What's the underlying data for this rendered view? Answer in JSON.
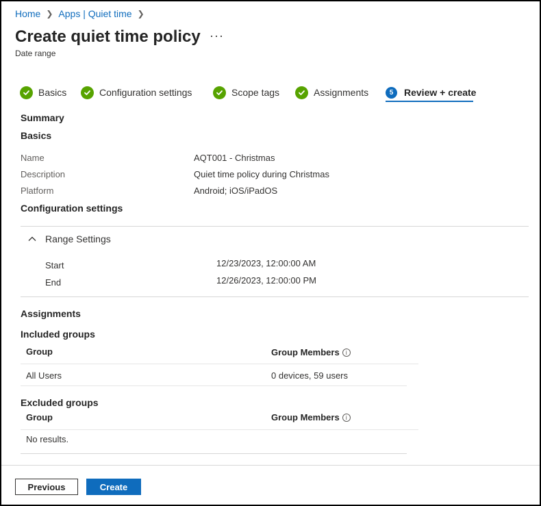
{
  "breadcrumb": {
    "items": [
      "Home",
      "Apps | Quiet time"
    ]
  },
  "header": {
    "title": "Create quiet time policy",
    "more": "···",
    "subtitle": "Date range"
  },
  "steps": [
    {
      "label": "Basics",
      "state": "done"
    },
    {
      "label": "Configuration settings",
      "state": "done"
    },
    {
      "label": "Scope tags",
      "state": "done"
    },
    {
      "label": "Assignments",
      "state": "done"
    },
    {
      "label": "Review + create",
      "number": "5",
      "state": "active"
    }
  ],
  "summary": {
    "heading": "Summary",
    "basics": {
      "heading": "Basics",
      "rows": [
        {
          "label": "Name",
          "value": "AQT001 - Christmas"
        },
        {
          "label": "Description",
          "value": "Quiet time policy during Christmas"
        },
        {
          "label": "Platform",
          "value": "Android; iOS/iPadOS"
        }
      ]
    },
    "config": {
      "heading": "Configuration settings",
      "group_title": "Range Settings",
      "rows": [
        {
          "label": "Start",
          "value": "12/23/2023, 12:00:00 AM"
        },
        {
          "label": "End",
          "value": "12/26/2023, 12:00:00 PM"
        }
      ]
    },
    "assignments": {
      "heading": "Assignments",
      "included": {
        "heading": "Included groups",
        "col_group": "Group",
        "col_members": "Group Members",
        "rows": [
          {
            "group": "All Users",
            "members": "0 devices, 59 users"
          }
        ]
      },
      "excluded": {
        "heading": "Excluded groups",
        "col_group": "Group",
        "col_members": "Group Members",
        "empty": "No results."
      }
    }
  },
  "footer": {
    "previous": "Previous",
    "create": "Create"
  },
  "colors": {
    "accent": "#0f6cbd",
    "success": "#57a300"
  },
  "icons": {
    "step_done": "check-circle-icon",
    "info": "info-icon",
    "collapse": "chevron-up-icon",
    "breadcrumb_sep": "chevron-right-icon"
  }
}
